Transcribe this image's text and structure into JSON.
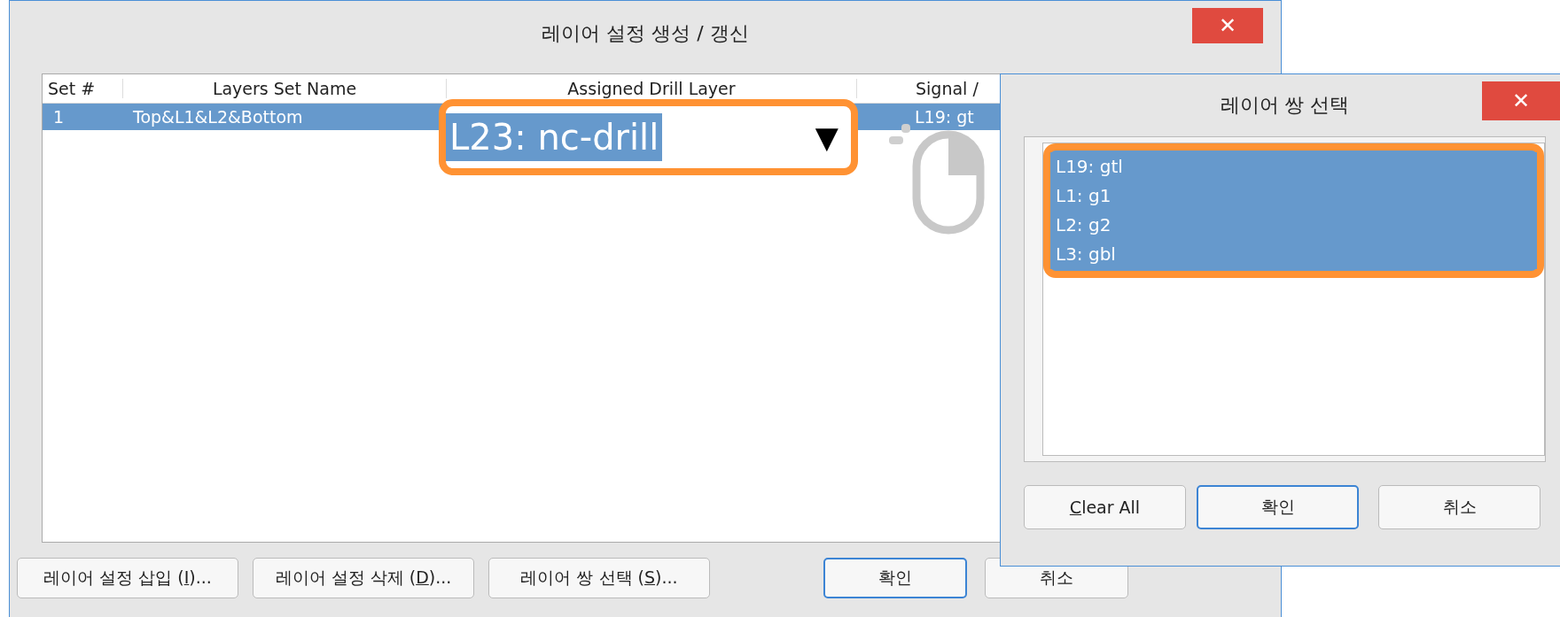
{
  "main_dialog": {
    "title": "레이어 설정 생성 / 갱신",
    "close": "✕",
    "table": {
      "columns": [
        "Set #",
        "Layers Set Name",
        "Assigned Drill Layer",
        "Signal /"
      ],
      "rows": [
        {
          "selected": true,
          "cells": [
            "1",
            "Top&L1&L2&Bottom",
            "",
            "L19: gt"
          ]
        }
      ]
    },
    "buttons": [
      {
        "before": "레이어 설정 삽입 (",
        "mnemonic": "I",
        "after": ")...",
        "kind": "plain"
      },
      {
        "before": "레이어 설정 삭제 (",
        "mnemonic": "D",
        "after": ")...",
        "kind": "plain"
      },
      {
        "before": "레이어 쌍 선택 (",
        "mnemonic": "S",
        "after": ")...",
        "kind": "plain"
      },
      {
        "before": "확인",
        "kind": "default"
      },
      {
        "before": "취소",
        "kind": "plain"
      }
    ]
  },
  "drill_dropdown": {
    "value": "L23: nc-drill",
    "arrow": "▼"
  },
  "pair_dialog": {
    "title": "레이어 쌍 선택",
    "close": "✕",
    "items": [
      {
        "label": "L19: gtl",
        "selected": true
      },
      {
        "label": "L1: g1",
        "selected": true
      },
      {
        "label": "L2: g2",
        "selected": true
      },
      {
        "label": "L3: gbl",
        "selected": true
      }
    ],
    "buttons": [
      {
        "mnemonic": "C",
        "after": "lear All",
        "kind": "plain"
      },
      {
        "before": "확인",
        "kind": "default"
      },
      {
        "before": "취소",
        "kind": "plain"
      }
    ]
  }
}
